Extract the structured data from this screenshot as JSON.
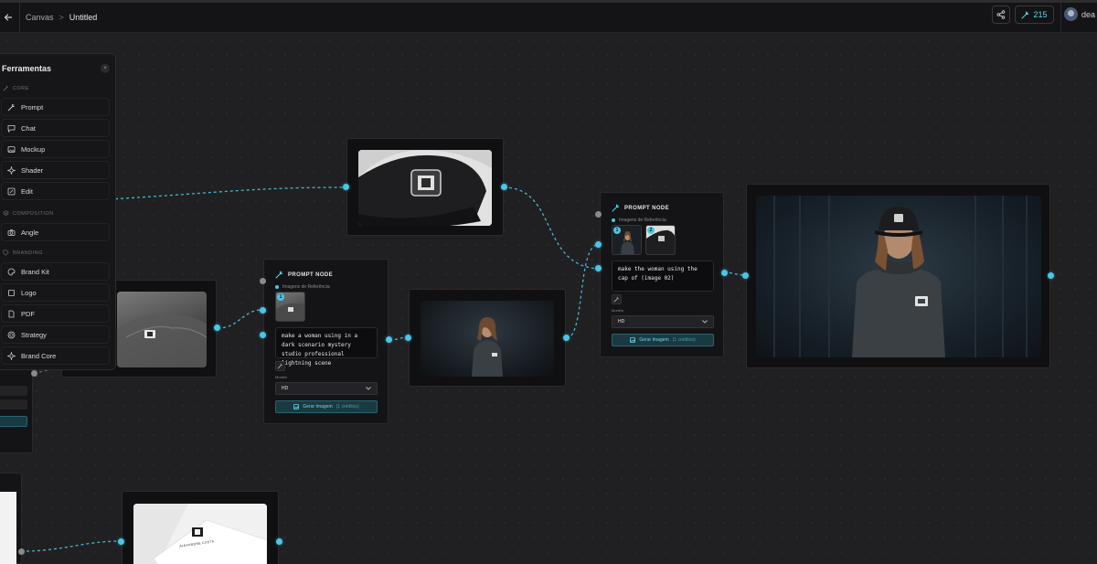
{
  "header": {
    "back_icon": "arrow-left-icon",
    "breadcrumb_root": "Canvas",
    "breadcrumb_sep": ">",
    "breadcrumb_current": "Untitled",
    "share_icon": "share-icon",
    "credits": "215",
    "credits_icon": "wand-icon",
    "user_name": "dea"
  },
  "tools_panel": {
    "title": "Ferramentas",
    "close_label": "×",
    "sections": [
      {
        "label": "CORE",
        "icon": "wand-icon"
      },
      {
        "label": "COMPOSITION",
        "icon": "layers-icon"
      },
      {
        "label": "BRANDING",
        "icon": "tag-icon"
      }
    ],
    "items": [
      {
        "label": "Prompt",
        "icon": "wand-icon"
      },
      {
        "label": "Chat",
        "icon": "chat-icon"
      },
      {
        "label": "Mockup",
        "icon": "image-icon"
      },
      {
        "label": "Shader",
        "icon": "sparkle-icon"
      },
      {
        "label": "Edit",
        "icon": "edit-icon"
      },
      {
        "label": "Angle",
        "icon": "camera-icon"
      },
      {
        "label": "Brand Kit",
        "icon": "palette-icon"
      },
      {
        "label": "Logo",
        "icon": "square-icon"
      },
      {
        "label": "PDF",
        "icon": "file-icon"
      },
      {
        "label": "Strategy",
        "icon": "target-icon"
      },
      {
        "label": "Brand Core",
        "icon": "sparkle-icon"
      }
    ]
  },
  "prompt_node_1": {
    "title": "PROMPT NODE",
    "ref_label": "Imagens de Referência",
    "ref_badges": [
      "1"
    ],
    "prompt": "make a woman using in a dark scenario mystery studio professional lightning scene",
    "model_label": "Modelo",
    "model_value": "HD",
    "generate_label": "Gerar Imagem",
    "generate_cost": "(1 créditos)"
  },
  "prompt_node_2": {
    "title": "PROMPT NODE",
    "ref_label": "Imagens de Referência",
    "ref_badges": [
      "1",
      "2"
    ],
    "prompt": "make the woman using the cap of (image 02)",
    "model_label": "Modelo",
    "model_value": "HD",
    "generate_label": "Gerar Imagem",
    "generate_cost": "(1 créditos)"
  },
  "business_card_text": "ALEXANDRE COSTA"
}
